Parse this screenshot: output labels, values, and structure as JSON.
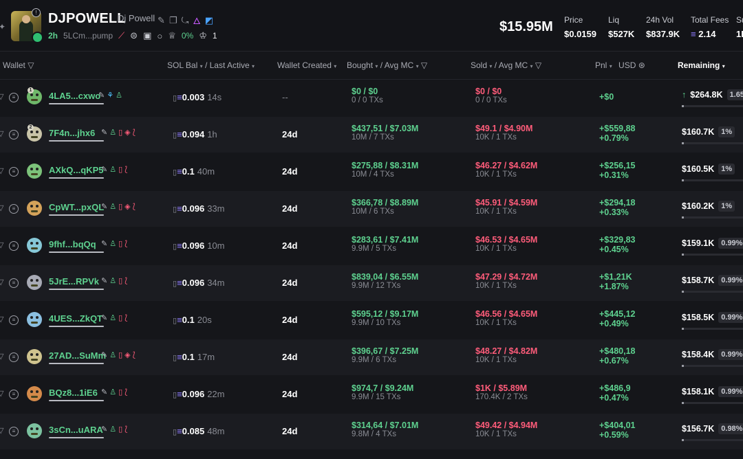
{
  "header": {
    "ticker": "DJPOWELL",
    "name": "Dj Powell",
    "age": "2h",
    "address": "5LCm...pump",
    "percent": "0%",
    "holders_count": "1",
    "market_cap": "$15.95M",
    "stats": [
      {
        "label": "Price",
        "value": "$0.0159"
      },
      {
        "label": "Liq",
        "value": "$527K"
      },
      {
        "label": "24h Vol",
        "value": "$837.9K"
      },
      {
        "label": "Total Fees",
        "value": "2.14",
        "sol": "≡"
      },
      {
        "label": "Su",
        "value": "1K"
      }
    ]
  },
  "columns": {
    "wallet": "Wallet",
    "sol_bal": "SOL Bal",
    "last_active": "/ Last Active",
    "wallet_created": "Wallet Created",
    "bought": "Bought",
    "avg_mc": "/ Avg MC",
    "sold": "Sold",
    "sold_avg_mc": "/ Avg MC",
    "pnl": "Pnl",
    "usd": "USD",
    "remaining": "Remaining"
  },
  "rows": [
    {
      "rank": "1",
      "wallet": "4LA5...cxwo",
      "sol": "0.003",
      "active": "14s",
      "created": "--",
      "bought": "$0",
      "bought_mc": "$0",
      "bought_sub": "0 / 0 TXs",
      "sold": "$0",
      "sold_mc": "$0",
      "sold_sub": "0 / 0 TXs",
      "pnl": "+$0",
      "pnl_pct": "",
      "remaining": "$264.8K",
      "rem_pct": "1.65",
      "up": true,
      "face": "#6fb86a",
      "icons": "ed"
    },
    {
      "rank": "2",
      "wallet": "7F4n...jhx6",
      "sol": "0.094",
      "active": "1h",
      "created": "24d",
      "bought": "$437,51",
      "bought_mc": "$7.03M",
      "bought_sub": "10M / 7 TXs",
      "sold": "$49.1",
      "sold_mc": "$4.90M",
      "sold_sub": "10K / 1 TXs",
      "pnl": "+$559,88",
      "pnl_pct": "+0.79%",
      "remaining": "$160.7K",
      "rem_pct": "1%",
      "up": false,
      "face": "#c9c4a8",
      "icons": "full"
    },
    {
      "rank": "",
      "wallet": "AXkQ...qKP5",
      "sol": "0.1",
      "active": "40m",
      "created": "24d",
      "bought": "$275,88",
      "bought_mc": "$8.31M",
      "bought_sub": "10M / 4 TXs",
      "sold": "$46.27",
      "sold_mc": "$4.62M",
      "sold_sub": "10K / 1 TXs",
      "pnl": "+$256,15",
      "pnl_pct": "+0.31%",
      "remaining": "$160.5K",
      "rem_pct": "1%",
      "up": false,
      "face": "#7cc27a",
      "icons": "std"
    },
    {
      "rank": "",
      "wallet": "CpWT...pxQL",
      "sol": "0.096",
      "active": "33m",
      "created": "24d",
      "bought": "$366,78",
      "bought_mc": "$8.89M",
      "bought_sub": "10M / 6 TXs",
      "sold": "$45.91",
      "sold_mc": "$4.59M",
      "sold_sub": "10K / 1 TXs",
      "pnl": "+$294,18",
      "pnl_pct": "+0.33%",
      "remaining": "$160.2K",
      "rem_pct": "1%",
      "up": false,
      "face": "#d4a25a",
      "icons": "full"
    },
    {
      "rank": "",
      "wallet": "9fhf...bqQq",
      "sol": "0.096",
      "active": "10m",
      "created": "24d",
      "bought": "$283,61",
      "bought_mc": "$7.41M",
      "bought_sub": "9.9M / 5 TXs",
      "sold": "$46.53",
      "sold_mc": "$4.65M",
      "sold_sub": "10K / 1 TXs",
      "pnl": "+$329,83",
      "pnl_pct": "+0.45%",
      "remaining": "$159.1K",
      "rem_pct": "0.99%",
      "up": false,
      "face": "#86c7d6",
      "icons": "short"
    },
    {
      "rank": "",
      "wallet": "5JrE...RPVk",
      "sol": "0.096",
      "active": "34m",
      "created": "24d",
      "bought": "$839,04",
      "bought_mc": "$6.55M",
      "bought_sub": "9.9M / 12 TXs",
      "sold": "$47.29",
      "sold_mc": "$4.72M",
      "sold_sub": "10K / 1 TXs",
      "pnl": "+$1,21K",
      "pnl_pct": "+1.87%",
      "remaining": "$158.7K",
      "rem_pct": "0.99%",
      "up": false,
      "face": "#a8aab5",
      "icons": "short"
    },
    {
      "rank": "",
      "wallet": "4UES...ZkQT",
      "sol": "0.1",
      "active": "20s",
      "created": "24d",
      "bought": "$595,12",
      "bought_mc": "$9.17M",
      "bought_sub": "9.9M / 10 TXs",
      "sold": "$46.56",
      "sold_mc": "$4.65M",
      "sold_sub": "10K / 1 TXs",
      "pnl": "+$445,12",
      "pnl_pct": "+0.49%",
      "remaining": "$158.5K",
      "rem_pct": "0.99%",
      "up": false,
      "face": "#8bbfe0",
      "icons": "std"
    },
    {
      "rank": "",
      "wallet": "27AD...SuMm",
      "sol": "0.1",
      "active": "17m",
      "created": "24d",
      "bought": "$396,67",
      "bought_mc": "$7.25M",
      "bought_sub": "9.9M / 6 TXs",
      "sold": "$48.27",
      "sold_mc": "$4.82M",
      "sold_sub": "10K / 1 TXs",
      "pnl": "+$480,18",
      "pnl_pct": "+0.67%",
      "remaining": "$158.4K",
      "rem_pct": "0.99%",
      "up": false,
      "face": "#cfc38e",
      "icons": "full"
    },
    {
      "rank": "",
      "wallet": "BQz8...1iE6",
      "sol": "0.096",
      "active": "22m",
      "created": "24d",
      "bought": "$974,7",
      "bought_mc": "$9.24M",
      "bought_sub": "9.9M / 15 TXs",
      "sold": "$1K",
      "sold_mc": "$5.89M",
      "sold_sub": "170.4K / 2 TXs",
      "pnl": "+$486,9",
      "pnl_pct": "+0.47%",
      "remaining": "$158.1K",
      "rem_pct": "0.99%",
      "up": false,
      "face": "#d48a4a",
      "icons": "std"
    },
    {
      "rank": "",
      "wallet": "3sCn...uARA",
      "sol": "0.085",
      "active": "48m",
      "created": "24d",
      "bought": "$314,64",
      "bought_mc": "$7.01M",
      "bought_sub": "9.8M / 4 TXs",
      "sold": "$49.42",
      "sold_mc": "$4.94M",
      "sold_sub": "10K / 1 TXs",
      "pnl": "+$404,01",
      "pnl_pct": "+0.59%",
      "remaining": "$156.7K",
      "rem_pct": "0.98%",
      "up": false,
      "face": "#7cc2a0",
      "icons": "short"
    }
  ]
}
